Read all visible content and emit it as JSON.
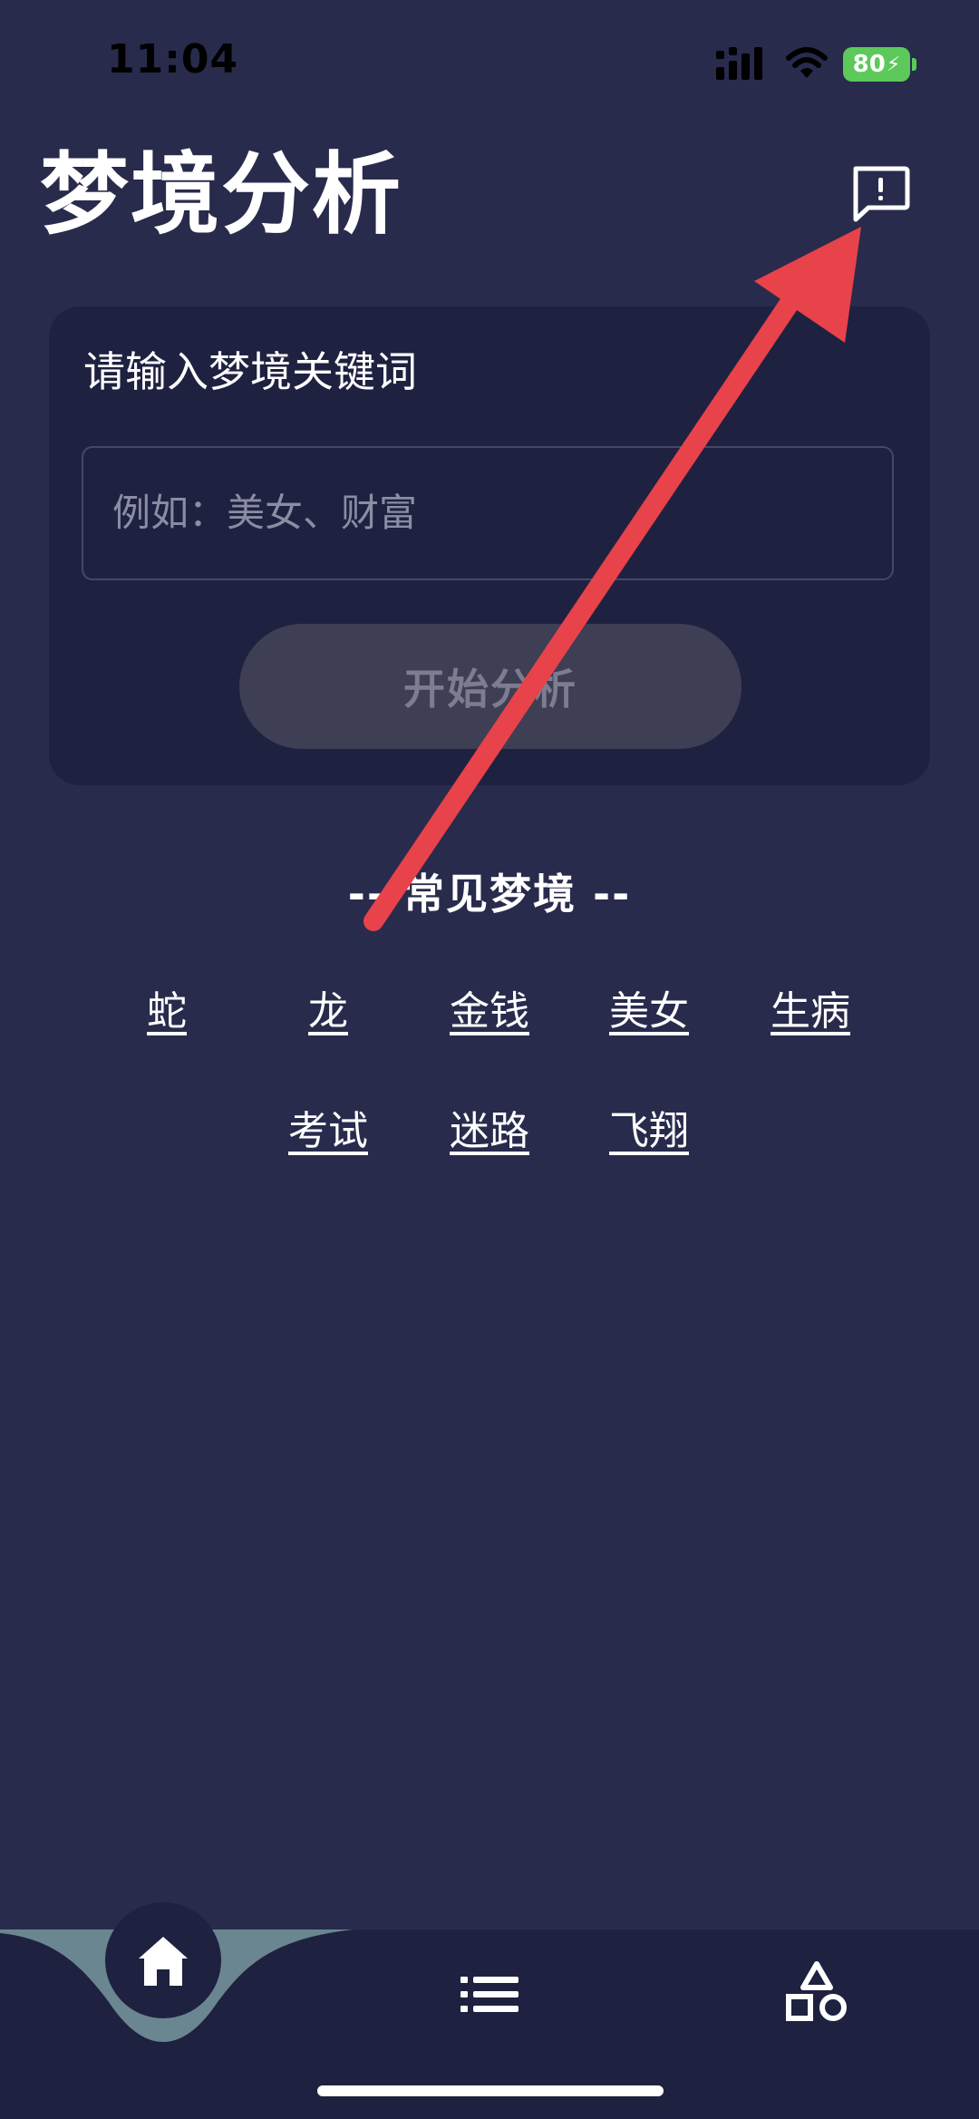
{
  "status_bar": {
    "time": "11:04",
    "battery": "80"
  },
  "header": {
    "title": "梦境分析",
    "feedback_icon": "message-alert-icon"
  },
  "search_card": {
    "label": "请输入梦境关键词",
    "input_placeholder": "例如：美女、财富",
    "input_value": "",
    "button_label": "开始分析"
  },
  "common_dreams": {
    "heading": "-- 常见梦境 --",
    "items": [
      "蛇",
      "龙",
      "金钱",
      "美女",
      "生病",
      "考试",
      "迷路",
      "飞翔"
    ]
  },
  "tab_bar": {
    "tabs": [
      {
        "name": "home",
        "icon": "home-icon",
        "active": true
      },
      {
        "name": "list",
        "icon": "list-icon",
        "active": false
      },
      {
        "name": "shapes",
        "icon": "shapes-icon",
        "active": false
      }
    ]
  },
  "colors": {
    "background": "#282b4c",
    "card": "#1f2140",
    "button_disabled": "#3e3e55",
    "tab_curve": "#6a8690",
    "annotation_arrow": "#e8424a"
  }
}
